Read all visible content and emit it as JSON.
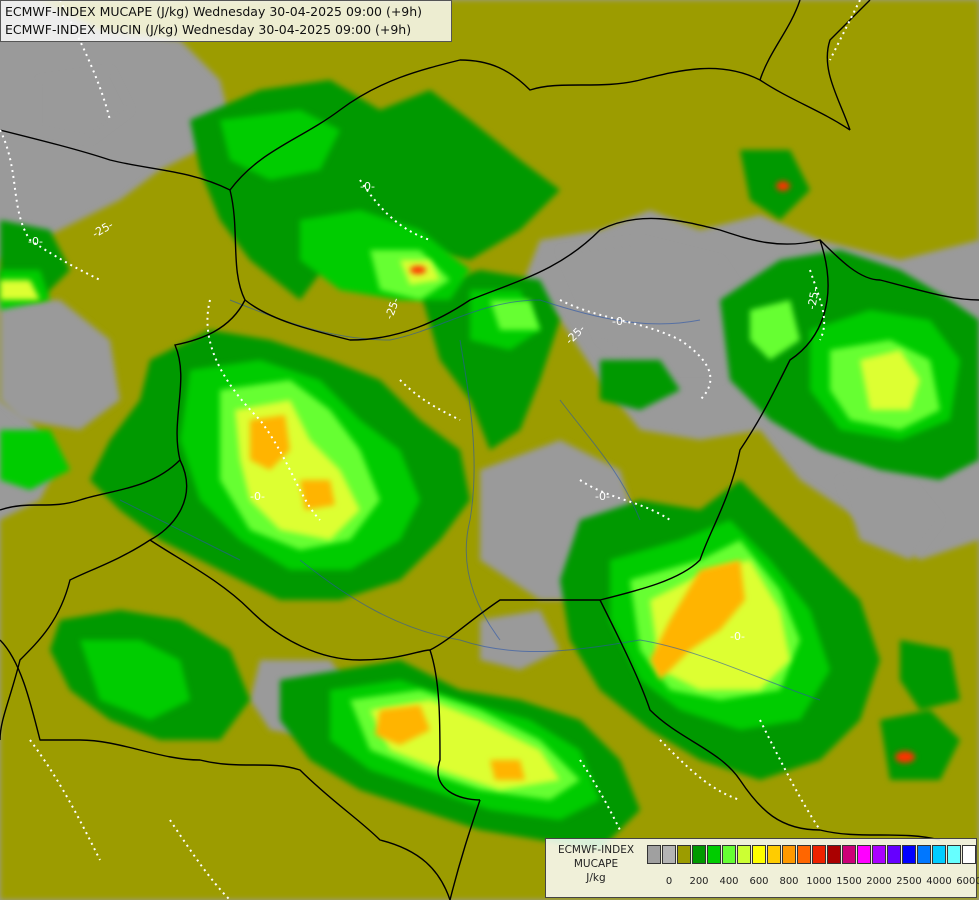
{
  "title": {
    "line1": "ECMWF-INDEX MUCAPE (J/kg) Wednesday 30-04-2025 09:00 (+9h)",
    "line2": "ECMWF-INDEX MUCIN (J/kg) Wednesday 30-04-2025 09:00 (+9h)"
  },
  "contour_labels": [
    "-0-",
    "-0-",
    "-0-",
    "-0-",
    "-0-",
    "-0-",
    "-25-",
    "-25-",
    "-25-",
    "-25-"
  ],
  "legend": {
    "line1": "ECMWF-INDEX",
    "line2": "MUCAPE",
    "line3": "J/kg",
    "colors": [
      "#a0a0a0",
      "#b4b4b4",
      "#9c9c00",
      "#009900",
      "#00cc00",
      "#66ff33",
      "#ccff33",
      "#ffff00",
      "#ffcc00",
      "#ff9900",
      "#ff6600",
      "#ee2200",
      "#aa0000",
      "#cc0077",
      "#ff00ff",
      "#aa00ff",
      "#6600ff",
      "#0000ff",
      "#0077ff",
      "#00ccff",
      "#66ffff",
      "#ffffff"
    ],
    "ticks": [
      "0",
      "200",
      "400",
      "600",
      "800",
      "1000",
      "1500",
      "2000",
      "2500",
      "4000",
      "6000"
    ]
  },
  "map_colors": {
    "background": "#9a9a9a",
    "olive": "#9c9c00",
    "dark_green": "#009900",
    "green": "#00cc00",
    "light_green": "#66ff33",
    "lime": "#ccff33",
    "yellow": "#ffff00",
    "orange": "#ffb400",
    "red": "#ff3300",
    "border": "#000000",
    "river": "#2a55aa"
  }
}
